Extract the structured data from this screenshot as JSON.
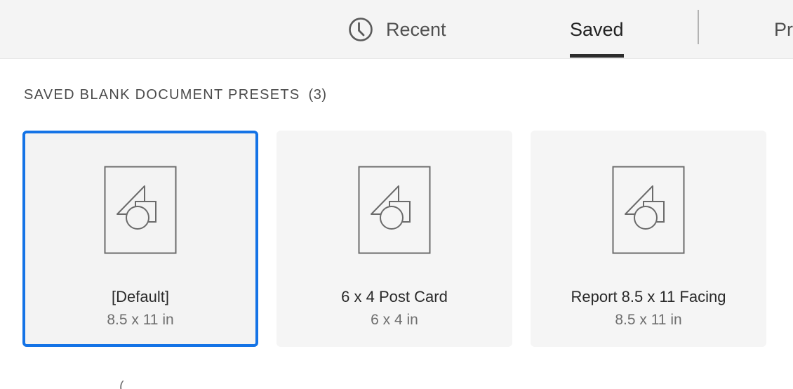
{
  "tabs": {
    "recent": {
      "label": "Recent",
      "icon": "clock-icon"
    },
    "saved": {
      "label": "Saved",
      "active": true
    },
    "presets": {
      "label": "Pr"
    }
  },
  "section": {
    "title": "SAVED BLANK DOCUMENT PRESETS",
    "count": "(3)"
  },
  "presets": [
    {
      "name": "[Default]",
      "size": "8.5 x 11 in",
      "selected": true,
      "icon": "document-preset-icon"
    },
    {
      "name": "6 x 4 Post Card",
      "size": "6 x 4 in",
      "selected": false,
      "icon": "document-preset-icon"
    },
    {
      "name": "Report 8.5 x 11 Facing",
      "size": "8.5 x 11 in",
      "selected": false,
      "icon": "document-preset-icon"
    }
  ],
  "bottom_hint": "(",
  "colors": {
    "accent": "#1473e6",
    "topbar_bg": "#f4f4f4",
    "card_bg": "#f5f5f5"
  }
}
